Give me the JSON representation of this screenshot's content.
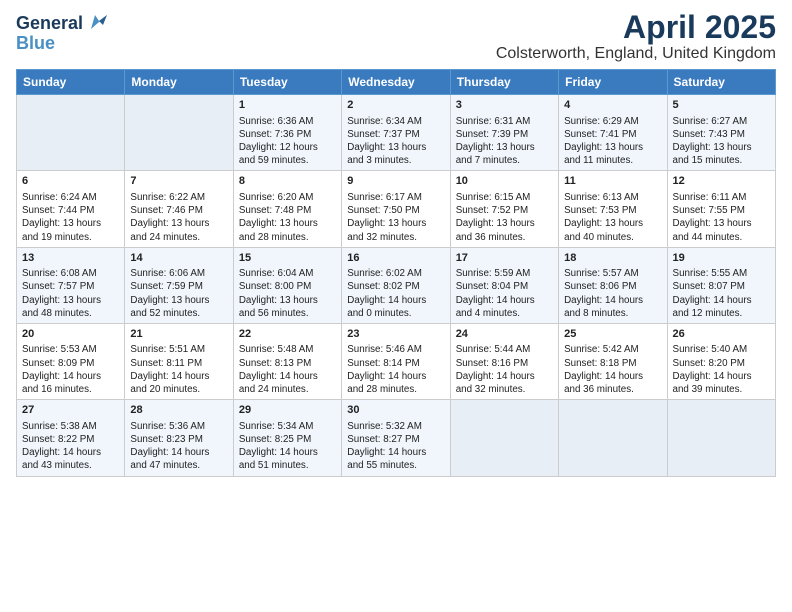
{
  "logo": {
    "line1": "General",
    "line2": "Blue"
  },
  "title": "April 2025",
  "subtitle": "Colsterworth, England, United Kingdom",
  "days_header": [
    "Sunday",
    "Monday",
    "Tuesday",
    "Wednesday",
    "Thursday",
    "Friday",
    "Saturday"
  ],
  "weeks": [
    [
      {
        "day": "",
        "info": ""
      },
      {
        "day": "",
        "info": ""
      },
      {
        "day": "1",
        "info": "Sunrise: 6:36 AM\nSunset: 7:36 PM\nDaylight: 12 hours\nand 59 minutes."
      },
      {
        "day": "2",
        "info": "Sunrise: 6:34 AM\nSunset: 7:37 PM\nDaylight: 13 hours\nand 3 minutes."
      },
      {
        "day": "3",
        "info": "Sunrise: 6:31 AM\nSunset: 7:39 PM\nDaylight: 13 hours\nand 7 minutes."
      },
      {
        "day": "4",
        "info": "Sunrise: 6:29 AM\nSunset: 7:41 PM\nDaylight: 13 hours\nand 11 minutes."
      },
      {
        "day": "5",
        "info": "Sunrise: 6:27 AM\nSunset: 7:43 PM\nDaylight: 13 hours\nand 15 minutes."
      }
    ],
    [
      {
        "day": "6",
        "info": "Sunrise: 6:24 AM\nSunset: 7:44 PM\nDaylight: 13 hours\nand 19 minutes."
      },
      {
        "day": "7",
        "info": "Sunrise: 6:22 AM\nSunset: 7:46 PM\nDaylight: 13 hours\nand 24 minutes."
      },
      {
        "day": "8",
        "info": "Sunrise: 6:20 AM\nSunset: 7:48 PM\nDaylight: 13 hours\nand 28 minutes."
      },
      {
        "day": "9",
        "info": "Sunrise: 6:17 AM\nSunset: 7:50 PM\nDaylight: 13 hours\nand 32 minutes."
      },
      {
        "day": "10",
        "info": "Sunrise: 6:15 AM\nSunset: 7:52 PM\nDaylight: 13 hours\nand 36 minutes."
      },
      {
        "day": "11",
        "info": "Sunrise: 6:13 AM\nSunset: 7:53 PM\nDaylight: 13 hours\nand 40 minutes."
      },
      {
        "day": "12",
        "info": "Sunrise: 6:11 AM\nSunset: 7:55 PM\nDaylight: 13 hours\nand 44 minutes."
      }
    ],
    [
      {
        "day": "13",
        "info": "Sunrise: 6:08 AM\nSunset: 7:57 PM\nDaylight: 13 hours\nand 48 minutes."
      },
      {
        "day": "14",
        "info": "Sunrise: 6:06 AM\nSunset: 7:59 PM\nDaylight: 13 hours\nand 52 minutes."
      },
      {
        "day": "15",
        "info": "Sunrise: 6:04 AM\nSunset: 8:00 PM\nDaylight: 13 hours\nand 56 minutes."
      },
      {
        "day": "16",
        "info": "Sunrise: 6:02 AM\nSunset: 8:02 PM\nDaylight: 14 hours\nand 0 minutes."
      },
      {
        "day": "17",
        "info": "Sunrise: 5:59 AM\nSunset: 8:04 PM\nDaylight: 14 hours\nand 4 minutes."
      },
      {
        "day": "18",
        "info": "Sunrise: 5:57 AM\nSunset: 8:06 PM\nDaylight: 14 hours\nand 8 minutes."
      },
      {
        "day": "19",
        "info": "Sunrise: 5:55 AM\nSunset: 8:07 PM\nDaylight: 14 hours\nand 12 minutes."
      }
    ],
    [
      {
        "day": "20",
        "info": "Sunrise: 5:53 AM\nSunset: 8:09 PM\nDaylight: 14 hours\nand 16 minutes."
      },
      {
        "day": "21",
        "info": "Sunrise: 5:51 AM\nSunset: 8:11 PM\nDaylight: 14 hours\nand 20 minutes."
      },
      {
        "day": "22",
        "info": "Sunrise: 5:48 AM\nSunset: 8:13 PM\nDaylight: 14 hours\nand 24 minutes."
      },
      {
        "day": "23",
        "info": "Sunrise: 5:46 AM\nSunset: 8:14 PM\nDaylight: 14 hours\nand 28 minutes."
      },
      {
        "day": "24",
        "info": "Sunrise: 5:44 AM\nSunset: 8:16 PM\nDaylight: 14 hours\nand 32 minutes."
      },
      {
        "day": "25",
        "info": "Sunrise: 5:42 AM\nSunset: 8:18 PM\nDaylight: 14 hours\nand 36 minutes."
      },
      {
        "day": "26",
        "info": "Sunrise: 5:40 AM\nSunset: 8:20 PM\nDaylight: 14 hours\nand 39 minutes."
      }
    ],
    [
      {
        "day": "27",
        "info": "Sunrise: 5:38 AM\nSunset: 8:22 PM\nDaylight: 14 hours\nand 43 minutes."
      },
      {
        "day": "28",
        "info": "Sunrise: 5:36 AM\nSunset: 8:23 PM\nDaylight: 14 hours\nand 47 minutes."
      },
      {
        "day": "29",
        "info": "Sunrise: 5:34 AM\nSunset: 8:25 PM\nDaylight: 14 hours\nand 51 minutes."
      },
      {
        "day": "30",
        "info": "Sunrise: 5:32 AM\nSunset: 8:27 PM\nDaylight: 14 hours\nand 55 minutes."
      },
      {
        "day": "",
        "info": ""
      },
      {
        "day": "",
        "info": ""
      },
      {
        "day": "",
        "info": ""
      }
    ]
  ]
}
